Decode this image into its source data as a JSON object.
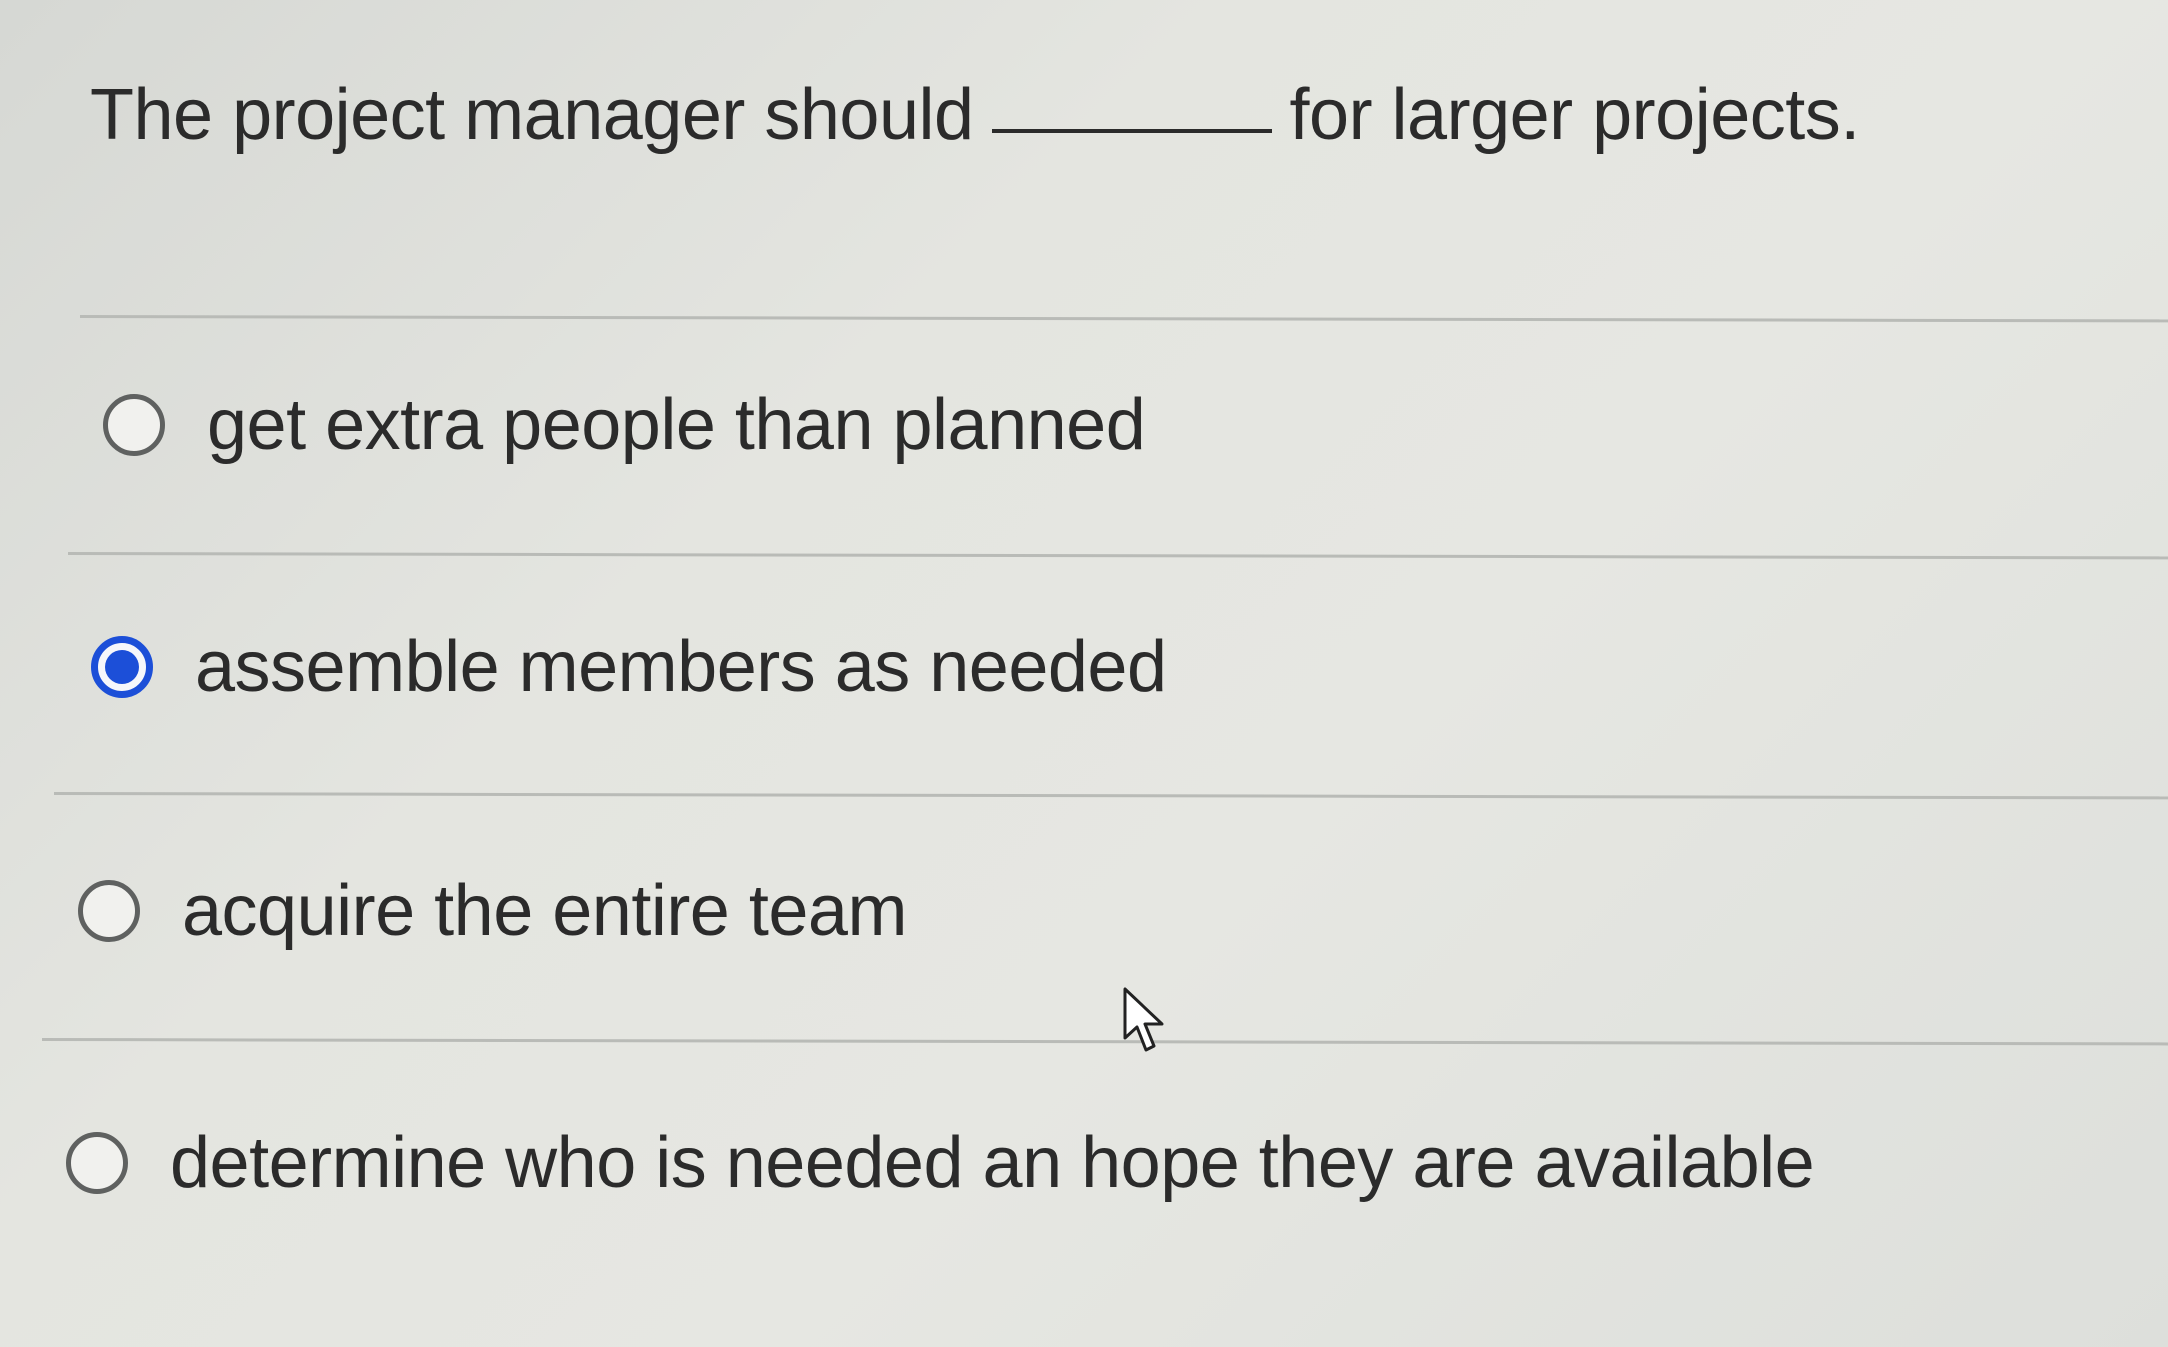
{
  "question": {
    "before_blank": "The project manager should",
    "after_blank": "for larger projects."
  },
  "options": [
    {
      "label": "get extra people than planned",
      "selected": false
    },
    {
      "label": "assemble members as needed",
      "selected": true
    },
    {
      "label": "acquire the entire team",
      "selected": false
    },
    {
      "label": "determine who is needed an hope they are available",
      "selected": false
    }
  ],
  "colors": {
    "selected_accent": "#1c4fd8",
    "text": "#2b2b2b",
    "background": "#e4e5e0"
  },
  "icons": {
    "cursor": "mouse-pointer-icon"
  }
}
